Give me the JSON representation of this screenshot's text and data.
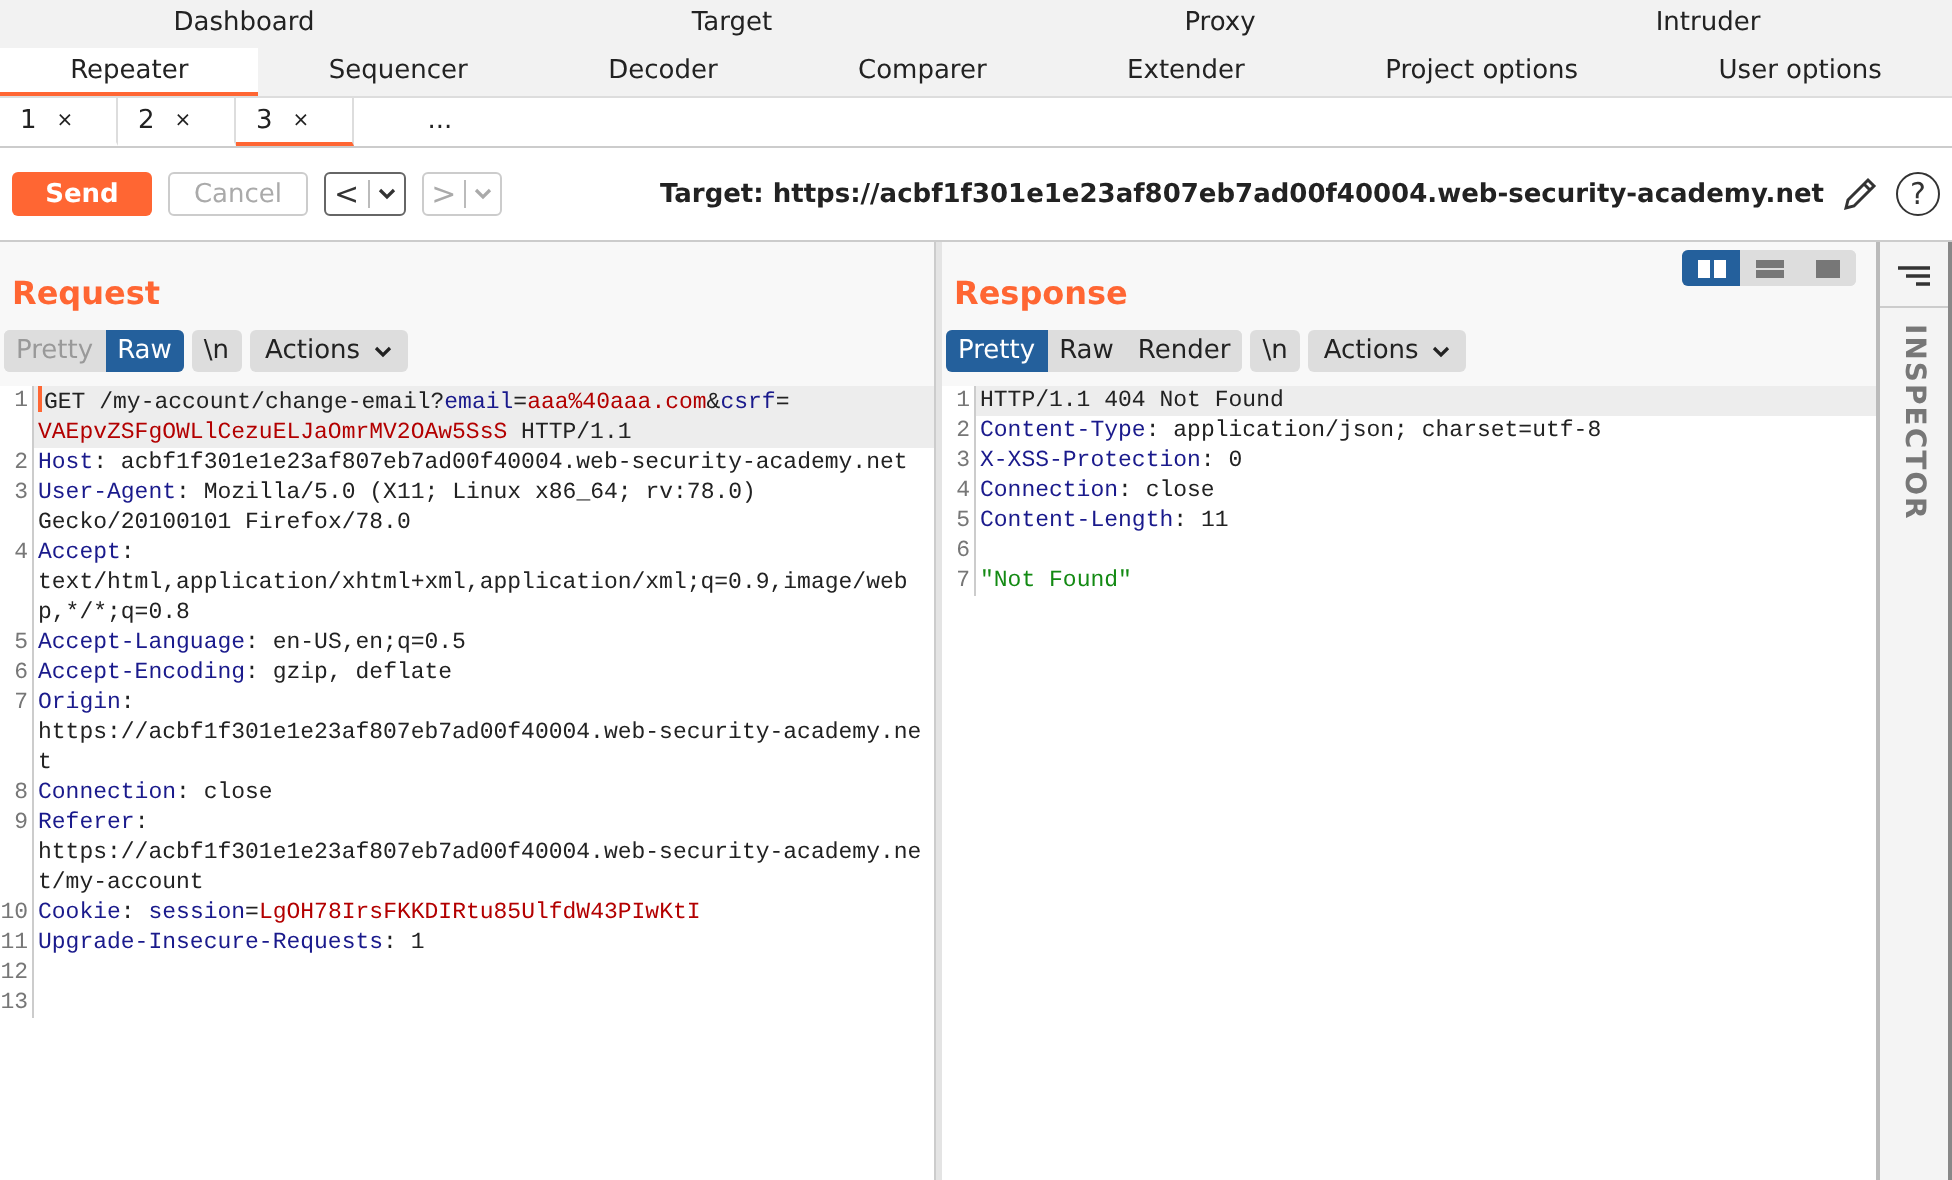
{
  "top_tabs": [
    {
      "label": "Dashboard",
      "selected": false
    },
    {
      "label": "Target",
      "selected": false
    },
    {
      "label": "Proxy",
      "selected": false
    },
    {
      "label": "Intruder",
      "selected": false
    }
  ],
  "tool_tabs": [
    {
      "label": "Repeater",
      "selected": true
    },
    {
      "label": "Sequencer",
      "selected": false
    },
    {
      "label": "Decoder",
      "selected": false
    },
    {
      "label": "Comparer",
      "selected": false
    },
    {
      "label": "Extender",
      "selected": false
    },
    {
      "label": "Project options",
      "selected": false
    },
    {
      "label": "User options",
      "selected": false
    }
  ],
  "request_tabs": [
    {
      "kind": "tab",
      "label": "1",
      "close": "×",
      "selected": false
    },
    {
      "kind": "tab",
      "label": "2",
      "close": "×",
      "selected": false
    },
    {
      "kind": "tab",
      "label": "3",
      "close": "×",
      "selected": true
    },
    {
      "kind": "more",
      "label": "...",
      "selected": false
    }
  ],
  "toolbar": {
    "send": "Send",
    "cancel": {
      "label": "Cancel",
      "disabled": true
    },
    "back": {
      "label": "<",
      "disabled": false
    },
    "forward": {
      "label": ">",
      "disabled": true
    },
    "target": "Target: https://acbf1f301e1e23af807eb7ad00f40004.web-security-academy.net",
    "help": "?"
  },
  "request": {
    "title": "Request",
    "views": [
      {
        "label": "Pretty",
        "selected": false
      },
      {
        "label": "Raw",
        "selected": true
      }
    ],
    "newline": "\\n",
    "actions": "Actions",
    "lines": [
      {
        "number": "1",
        "current": true,
        "segments": [
          {
            "kind": "plain",
            "text": "GET /my-account/change-email?"
          },
          {
            "kind": "key",
            "text": "email"
          },
          {
            "kind": "plain",
            "text": "="
          },
          {
            "kind": "value",
            "text": "aaa%40aaa.com"
          },
          {
            "kind": "plain",
            "text": "&"
          },
          {
            "kind": "key",
            "text": "csrf"
          },
          {
            "kind": "plain",
            "text": "="
          },
          {
            "kind": "value",
            "text": "VAEpvZSFgOWLlCezuELJaOmrMV2OAw5SsS"
          },
          {
            "kind": "plain",
            "text": " HTTP/1.1"
          }
        ]
      },
      {
        "number": "2",
        "current": false,
        "segments": [
          {
            "kind": "key",
            "text": "Host"
          },
          {
            "kind": "plain",
            "text": ": acbf1f301e1e23af807eb7ad00f40004.web-security-academy.net"
          }
        ]
      },
      {
        "number": "3",
        "current": false,
        "segments": [
          {
            "kind": "key",
            "text": "User-Agent"
          },
          {
            "kind": "plain",
            "text": ": Mozilla/5.0 (X11; Linux x86_64; rv:78.0) Gecko/20100101 Firefox/78.0"
          }
        ]
      },
      {
        "number": "4",
        "current": false,
        "segments": [
          {
            "kind": "key",
            "text": "Accept"
          },
          {
            "kind": "plain",
            "text": ": text/html,application/xhtml+xml,application/xml;q=0.9,image/webp,*/*;q=0.8"
          }
        ]
      },
      {
        "number": "5",
        "current": false,
        "segments": [
          {
            "kind": "key",
            "text": "Accept-Language"
          },
          {
            "kind": "plain",
            "text": ": en-US,en;q=0.5"
          }
        ]
      },
      {
        "number": "6",
        "current": false,
        "segments": [
          {
            "kind": "key",
            "text": "Accept-Encoding"
          },
          {
            "kind": "plain",
            "text": ": gzip, deflate"
          }
        ]
      },
      {
        "number": "7",
        "current": false,
        "segments": [
          {
            "kind": "key",
            "text": "Origin"
          },
          {
            "kind": "plain",
            "text": ": https://acbf1f301e1e23af807eb7ad00f40004.web-security-academy.net"
          }
        ]
      },
      {
        "number": "8",
        "current": false,
        "segments": [
          {
            "kind": "key",
            "text": "Connection"
          },
          {
            "kind": "plain",
            "text": ": close"
          }
        ]
      },
      {
        "number": "9",
        "current": false,
        "segments": [
          {
            "kind": "key",
            "text": "Referer"
          },
          {
            "kind": "plain",
            "text": ": https://acbf1f301e1e23af807eb7ad00f40004.web-security-academy.net/my-account"
          }
        ]
      },
      {
        "number": "10",
        "current": false,
        "segments": [
          {
            "kind": "key",
            "text": "Cookie"
          },
          {
            "kind": "plain",
            "text": ": "
          },
          {
            "kind": "key",
            "text": "session"
          },
          {
            "kind": "plain",
            "text": "="
          },
          {
            "kind": "value",
            "text": "LgOH78IrsFKKDIRtu85UlfdW43PIwKtI"
          }
        ]
      },
      {
        "number": "11",
        "current": false,
        "segments": [
          {
            "kind": "key",
            "text": "Upgrade-Insecure-Requests"
          },
          {
            "kind": "plain",
            "text": ": 1"
          }
        ]
      },
      {
        "number": "12",
        "current": false
      },
      {
        "number": "13",
        "current": false
      }
    ]
  },
  "response": {
    "title": "Response",
    "layouts": [
      {
        "kind": "split",
        "selected": true
      },
      {
        "kind": "stacked",
        "selected": false
      },
      {
        "kind": "single",
        "selected": false
      }
    ],
    "views": [
      {
        "label": "Pretty",
        "selected": true
      },
      {
        "label": "Raw",
        "selected": false
      },
      {
        "label": "Render",
        "selected": false
      }
    ],
    "newline": "\\n",
    "actions": "Actions",
    "lines": [
      {
        "number": "1",
        "current": true,
        "segments": [
          {
            "kind": "plain",
            "text": "HTTP/1.1 404 Not Found"
          }
        ]
      },
      {
        "number": "2",
        "current": false,
        "segments": [
          {
            "kind": "key",
            "text": "Content-Type"
          },
          {
            "kind": "plain",
            "text": ": application/json; charset=utf-8"
          }
        ]
      },
      {
        "number": "3",
        "current": false,
        "segments": [
          {
            "kind": "key",
            "text": "X-XSS-Protection"
          },
          {
            "kind": "plain",
            "text": ": 0"
          }
        ]
      },
      {
        "number": "4",
        "current": false,
        "segments": [
          {
            "kind": "key",
            "text": "Connection"
          },
          {
            "kind": "plain",
            "text": ": close"
          }
        ]
      },
      {
        "number": "5",
        "current": false,
        "segments": [
          {
            "kind": "key",
            "text": "Content-Length"
          },
          {
            "kind": "plain",
            "text": ": 11"
          }
        ]
      },
      {
        "number": "6",
        "current": false
      },
      {
        "number": "7",
        "current": false,
        "segments": [
          {
            "kind": "string",
            "text": "\"Not Found\""
          }
        ]
      }
    ]
  },
  "inspector": {
    "label": "INSPECTOR"
  }
}
